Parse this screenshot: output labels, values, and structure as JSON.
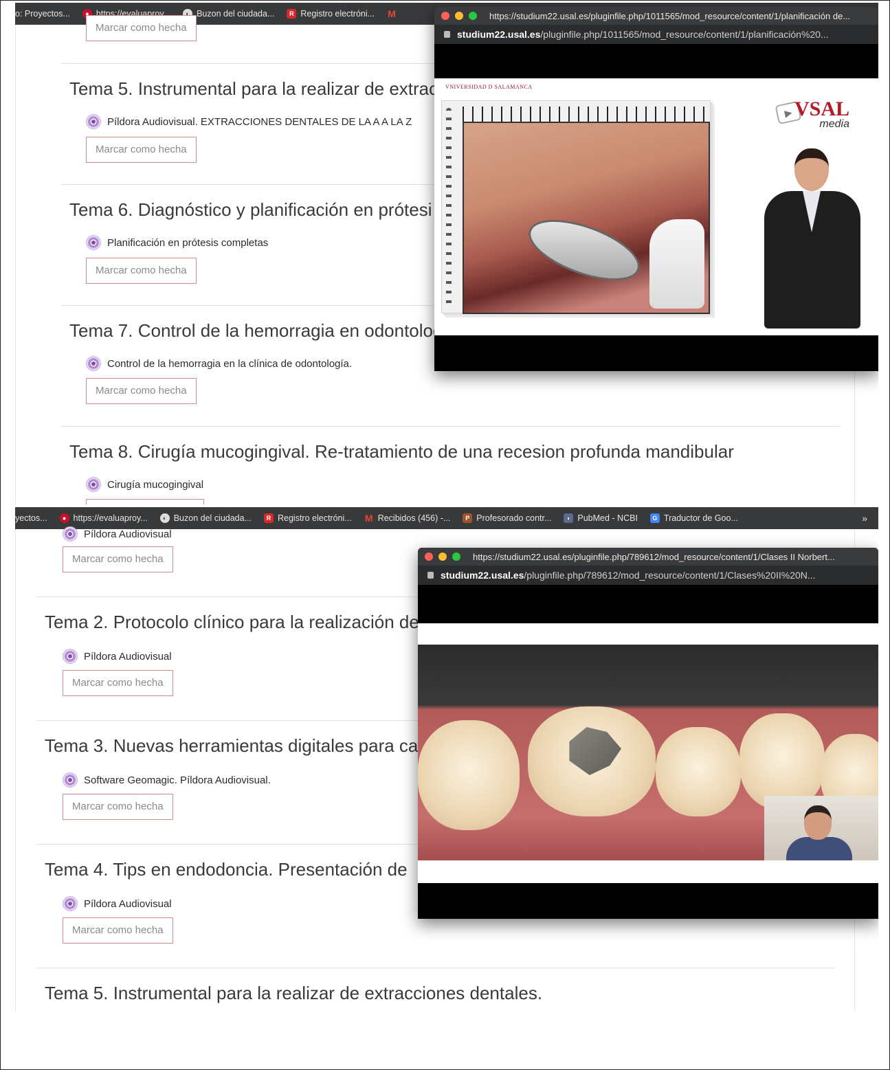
{
  "shot1": {
    "bookmarks": [
      {
        "label": "o: Proyectos...",
        "icon": "none"
      },
      {
        "label": "https://evaluaproy...",
        "icon": "usal-seal-icon"
      },
      {
        "label": "Buzon del ciudada...",
        "icon": "globe-icon"
      },
      {
        "label": "Registro electróni...",
        "icon": "registro-icon"
      },
      {
        "label": "",
        "icon": "gmail-icon"
      }
    ],
    "partial_button": "Marcar como hecha",
    "temas": [
      {
        "title": "Tema 5. Instrumental para la realizar de extrac",
        "resource": "Píldora Audiovisual. EXTRACCIONES DENTALES DE LA A A LA Z",
        "button": "Marcar como hecha"
      },
      {
        "title": "Tema 6. Diagnóstico y planificación en prótesi",
        "resource": "Planificación en prótesis completas",
        "button": "Marcar como hecha"
      },
      {
        "title": "Tema 7. Control de la hemorragia en odontolog",
        "resource": "Control de la hemorragia en la clínica de odontología.",
        "button": "Marcar como hecha"
      },
      {
        "title": "Tema 8. Cirugía mucogingival. Re-tratamiento de una recesion profunda mandibular",
        "resource": "Cirugía mucogingival",
        "button": ""
      }
    ],
    "popup": {
      "url_full": "https://studium22.usal.es/pluginfile.php/1011565/mod_resource/content/1/planificación de...",
      "host": "studium22.usal.es",
      "path": "/pluginfile.php/1011565/mod_resource/content/1/planificación%20...",
      "university": "VNIVERSIDAD D SALAMANCA",
      "brand": "VSAL",
      "brand_sub": "media"
    }
  },
  "shot2": {
    "bookmarks": [
      {
        "label": "yectos...",
        "icon": "none"
      },
      {
        "label": "https://evaluaproy...",
        "icon": "usal-seal-icon"
      },
      {
        "label": "Buzon del ciudada...",
        "icon": "globe-icon"
      },
      {
        "label": "Registro electróni...",
        "icon": "registro-icon"
      },
      {
        "label": "Recibidos (456) -...",
        "icon": "gmail-icon"
      },
      {
        "label": "Profesorado contr...",
        "icon": "profesorado-icon"
      },
      {
        "label": "PubMed - NCBI",
        "icon": "pubmed-icon"
      },
      {
        "label": "Traductor de Goo...",
        "icon": "translate-icon"
      }
    ],
    "overflow": "»",
    "partial_resource": "Píldora Audiovisual",
    "partial_button": "Marcar como hecha",
    "temas": [
      {
        "title": "Tema 2. Protocolo clínico para la realización de",
        "resource": "Píldora Audiovisual",
        "button": "Marcar como hecha"
      },
      {
        "title": "Tema 3. Nuevas herramientas digitales para ca",
        "resource": "Software Geomagic. Píldora Audiovisual.",
        "button": "Marcar como hecha"
      },
      {
        "title": "Tema 4. Tips en endodoncia. Presentación de",
        "resource": "Píldora Audiovisual",
        "button": "Marcar como hecha"
      },
      {
        "title": "Tema 5. Instrumental para la realizar de extracciones dentales.",
        "resource": "",
        "button": ""
      }
    ],
    "popup": {
      "url_full": "https://studium22.usal.es/pluginfile.php/789612/mod_resource/content/1/Clases II Norbert...",
      "host": "studium22.usal.es",
      "path": "/pluginfile.php/789612/mod_resource/content/1/Clases%20II%20N..."
    }
  }
}
